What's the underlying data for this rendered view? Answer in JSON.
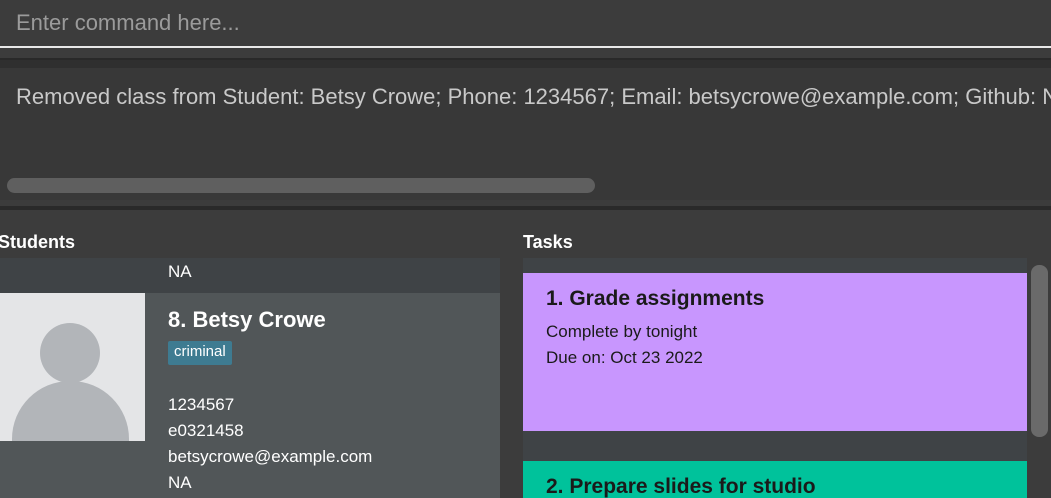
{
  "command": {
    "placeholder": "Enter command here..."
  },
  "result": {
    "text": "Removed class from Student: Betsy Crowe; Phone: 1234567; Email: betsycrowe@example.com; Github: NA"
  },
  "students": {
    "title": "Students",
    "prev_card": {
      "last_field": "NA"
    },
    "card": {
      "index_name": "8.  Betsy Crowe",
      "tag": "criminal",
      "phone": "1234567",
      "student_id": "e0321458",
      "email": "betsycrowe@example.com",
      "github": "NA"
    }
  },
  "tasks": {
    "title": "Tasks",
    "items": [
      {
        "title": "1.  Grade assignments",
        "description": "Complete by tonight",
        "due": "Due on: Oct 23 2022",
        "color": "#c896fe"
      },
      {
        "title": "2.  Prepare slides for studio",
        "color": "#00c29b"
      }
    ]
  }
}
